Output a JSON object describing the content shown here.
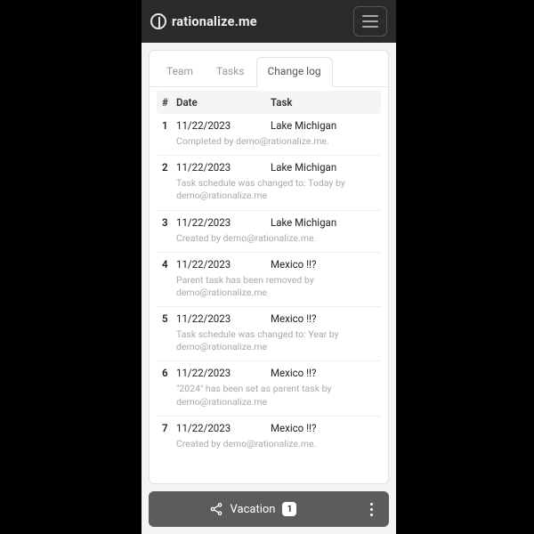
{
  "header": {
    "brand": "rationalize.me"
  },
  "tabs": [
    {
      "label": "Team",
      "active": false
    },
    {
      "label": "Tasks",
      "active": false
    },
    {
      "label": "Change log",
      "active": true
    }
  ],
  "table": {
    "headers": {
      "num": "#",
      "date": "Date",
      "task": "Task"
    },
    "rows": [
      {
        "num": "1",
        "date": "11/22/2023",
        "task": "Lake Michigan",
        "detail": "Completed by demo@rationalize.me."
      },
      {
        "num": "2",
        "date": "11/22/2023",
        "task": "Lake Michigan",
        "detail": "Task schedule was changed to: Today by demo@rationalize.me"
      },
      {
        "num": "3",
        "date": "11/22/2023",
        "task": "Lake Michigan",
        "detail": "Created by demo@rationalize.me."
      },
      {
        "num": "4",
        "date": "11/22/2023",
        "task": "Mexico !!?",
        "detail": "Parent task has been removed by demo@rationalize.me"
      },
      {
        "num": "5",
        "date": "11/22/2023",
        "task": "Mexico !!?",
        "detail": "Task schedule was changed to: Year by demo@rationalize.me"
      },
      {
        "num": "6",
        "date": "11/22/2023",
        "task": "Mexico !!?",
        "detail": "\"2024\" has been set as parent task by demo@rationalize.me"
      },
      {
        "num": "7",
        "date": "11/22/2023",
        "task": "Mexico !!?",
        "detail": "Created by demo@rationalize.me."
      }
    ]
  },
  "footer": {
    "label": "Vacation",
    "badge": "1"
  }
}
